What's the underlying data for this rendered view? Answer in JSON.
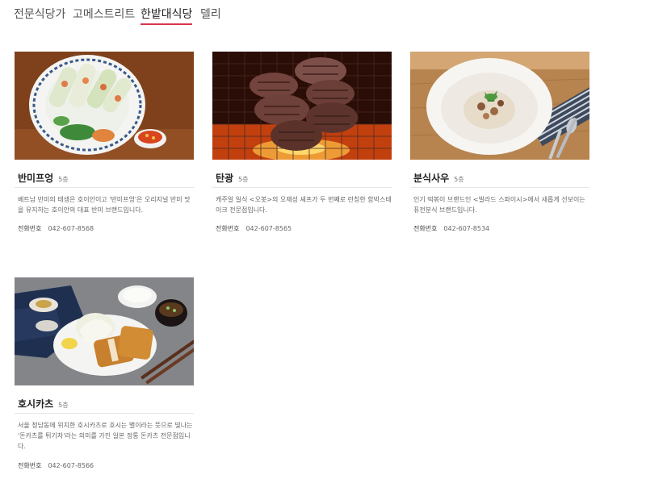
{
  "tabs": [
    {
      "label": "전문식당가",
      "active": false
    },
    {
      "label": "고메스트리트",
      "active": false
    },
    {
      "label": "한밭대식당",
      "active": true
    },
    {
      "label": "델리",
      "active": false
    }
  ],
  "phone_label": "전화번호",
  "stores": [
    {
      "name": "반미프엉",
      "floor": "5층",
      "description": "베트남 반미의 태생은 호이안이고 '반미프엉'은 오리지널 반미 맛을 유지하는 호이안의 대표 반미 브랜드입니다.",
      "phone": "042-607-8568",
      "image_icon": "spring-rolls-food-photo"
    },
    {
      "name": "탄광",
      "floor": "5층",
      "description": "캐주얼 일식 <오봇>의 오재성 셰프가 두 번째로 런칭한 함박스테이크 전문점입니다.",
      "phone": "042-607-8565",
      "image_icon": "grilled-steak-food-photo"
    },
    {
      "name": "분식사우",
      "floor": "5층",
      "description": "인기 떡볶이 브랜드인 <빌라드 스파이시>에서 새롭게 선보이는 퓨전분식 브랜드입니다.",
      "phone": "042-607-8534",
      "image_icon": "fusion-dish-food-photo"
    },
    {
      "name": "호시카츠",
      "floor": "5층",
      "description": "서울 청담동에 위치한 호시카츠로 호시는 별이라는 뜻으로 빛나는 '돈카츠를 튀기자'라는 의미를 가진 일본 정통 돈카츠 전문점입니다.",
      "phone": "042-607-8566",
      "image_icon": "tonkatsu-set-food-photo"
    }
  ]
}
